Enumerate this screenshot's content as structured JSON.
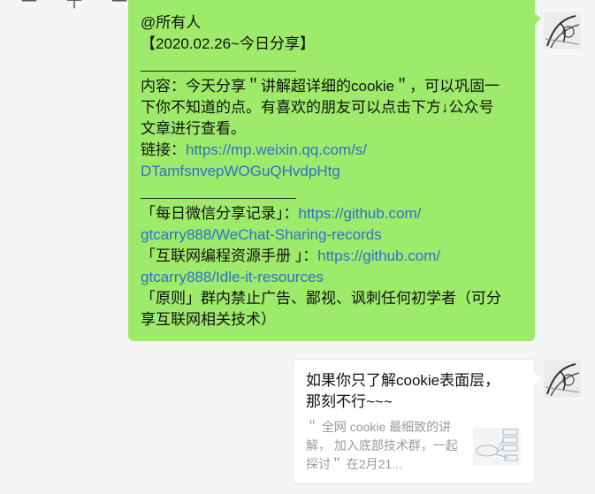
{
  "top_fragment": "一 十 一 十 一",
  "message_green": {
    "lines": [
      {
        "type": "text",
        "text": "@所有人"
      },
      {
        "type": "text",
        "text": "【2020.02.26~今日分享】"
      },
      {
        "type": "rule"
      },
      {
        "type": "text",
        "text": "内容：今天分享＂讲解超详细的cookie＂，可以巩固一"
      },
      {
        "type": "text",
        "text": "下你不知道的点。有喜欢的朋友可以点击下方↓公众号"
      },
      {
        "type": "text",
        "text": "文章进行查看。"
      },
      {
        "type": "mixed",
        "text": "链接：",
        "link": "https://mp.weixin.qq.com/s/"
      },
      {
        "type": "link",
        "text": "DTamfsnvepWOGuQHvdpHtg"
      },
      {
        "type": "rule"
      },
      {
        "type": "mixed",
        "text": "「每日微信分享记录」：",
        "link": "https://github.com/"
      },
      {
        "type": "link",
        "text": "gtcarry888/WeChat-Sharing-records"
      },
      {
        "type": "mixed",
        "text": "「互联网编程资源手册 」：",
        "link": "https://github.com/"
      },
      {
        "type": "link",
        "text": "gtcarry888/Idle-it-resources"
      },
      {
        "type": "text",
        "text": "「原则」群内禁止广告、鄙视、讽刺任何初学者（可分"
      },
      {
        "type": "text",
        "text": "享互联网相关技术）"
      }
    ]
  },
  "article_card": {
    "title": "如果你只了解cookie表面层，那刻不行~~~",
    "description": "＂ 全网 cookie 最细致的讲解， 加入底部技术群，一起探讨＂    在2月21..."
  },
  "avatar_icon": "sketch-avatar-icon",
  "thumbnail_icon": "diagram-thumbnail-icon",
  "colors": {
    "bubble_green": "#9eea6a",
    "link": "#2f6fcf",
    "background": "#f5f5f5"
  }
}
